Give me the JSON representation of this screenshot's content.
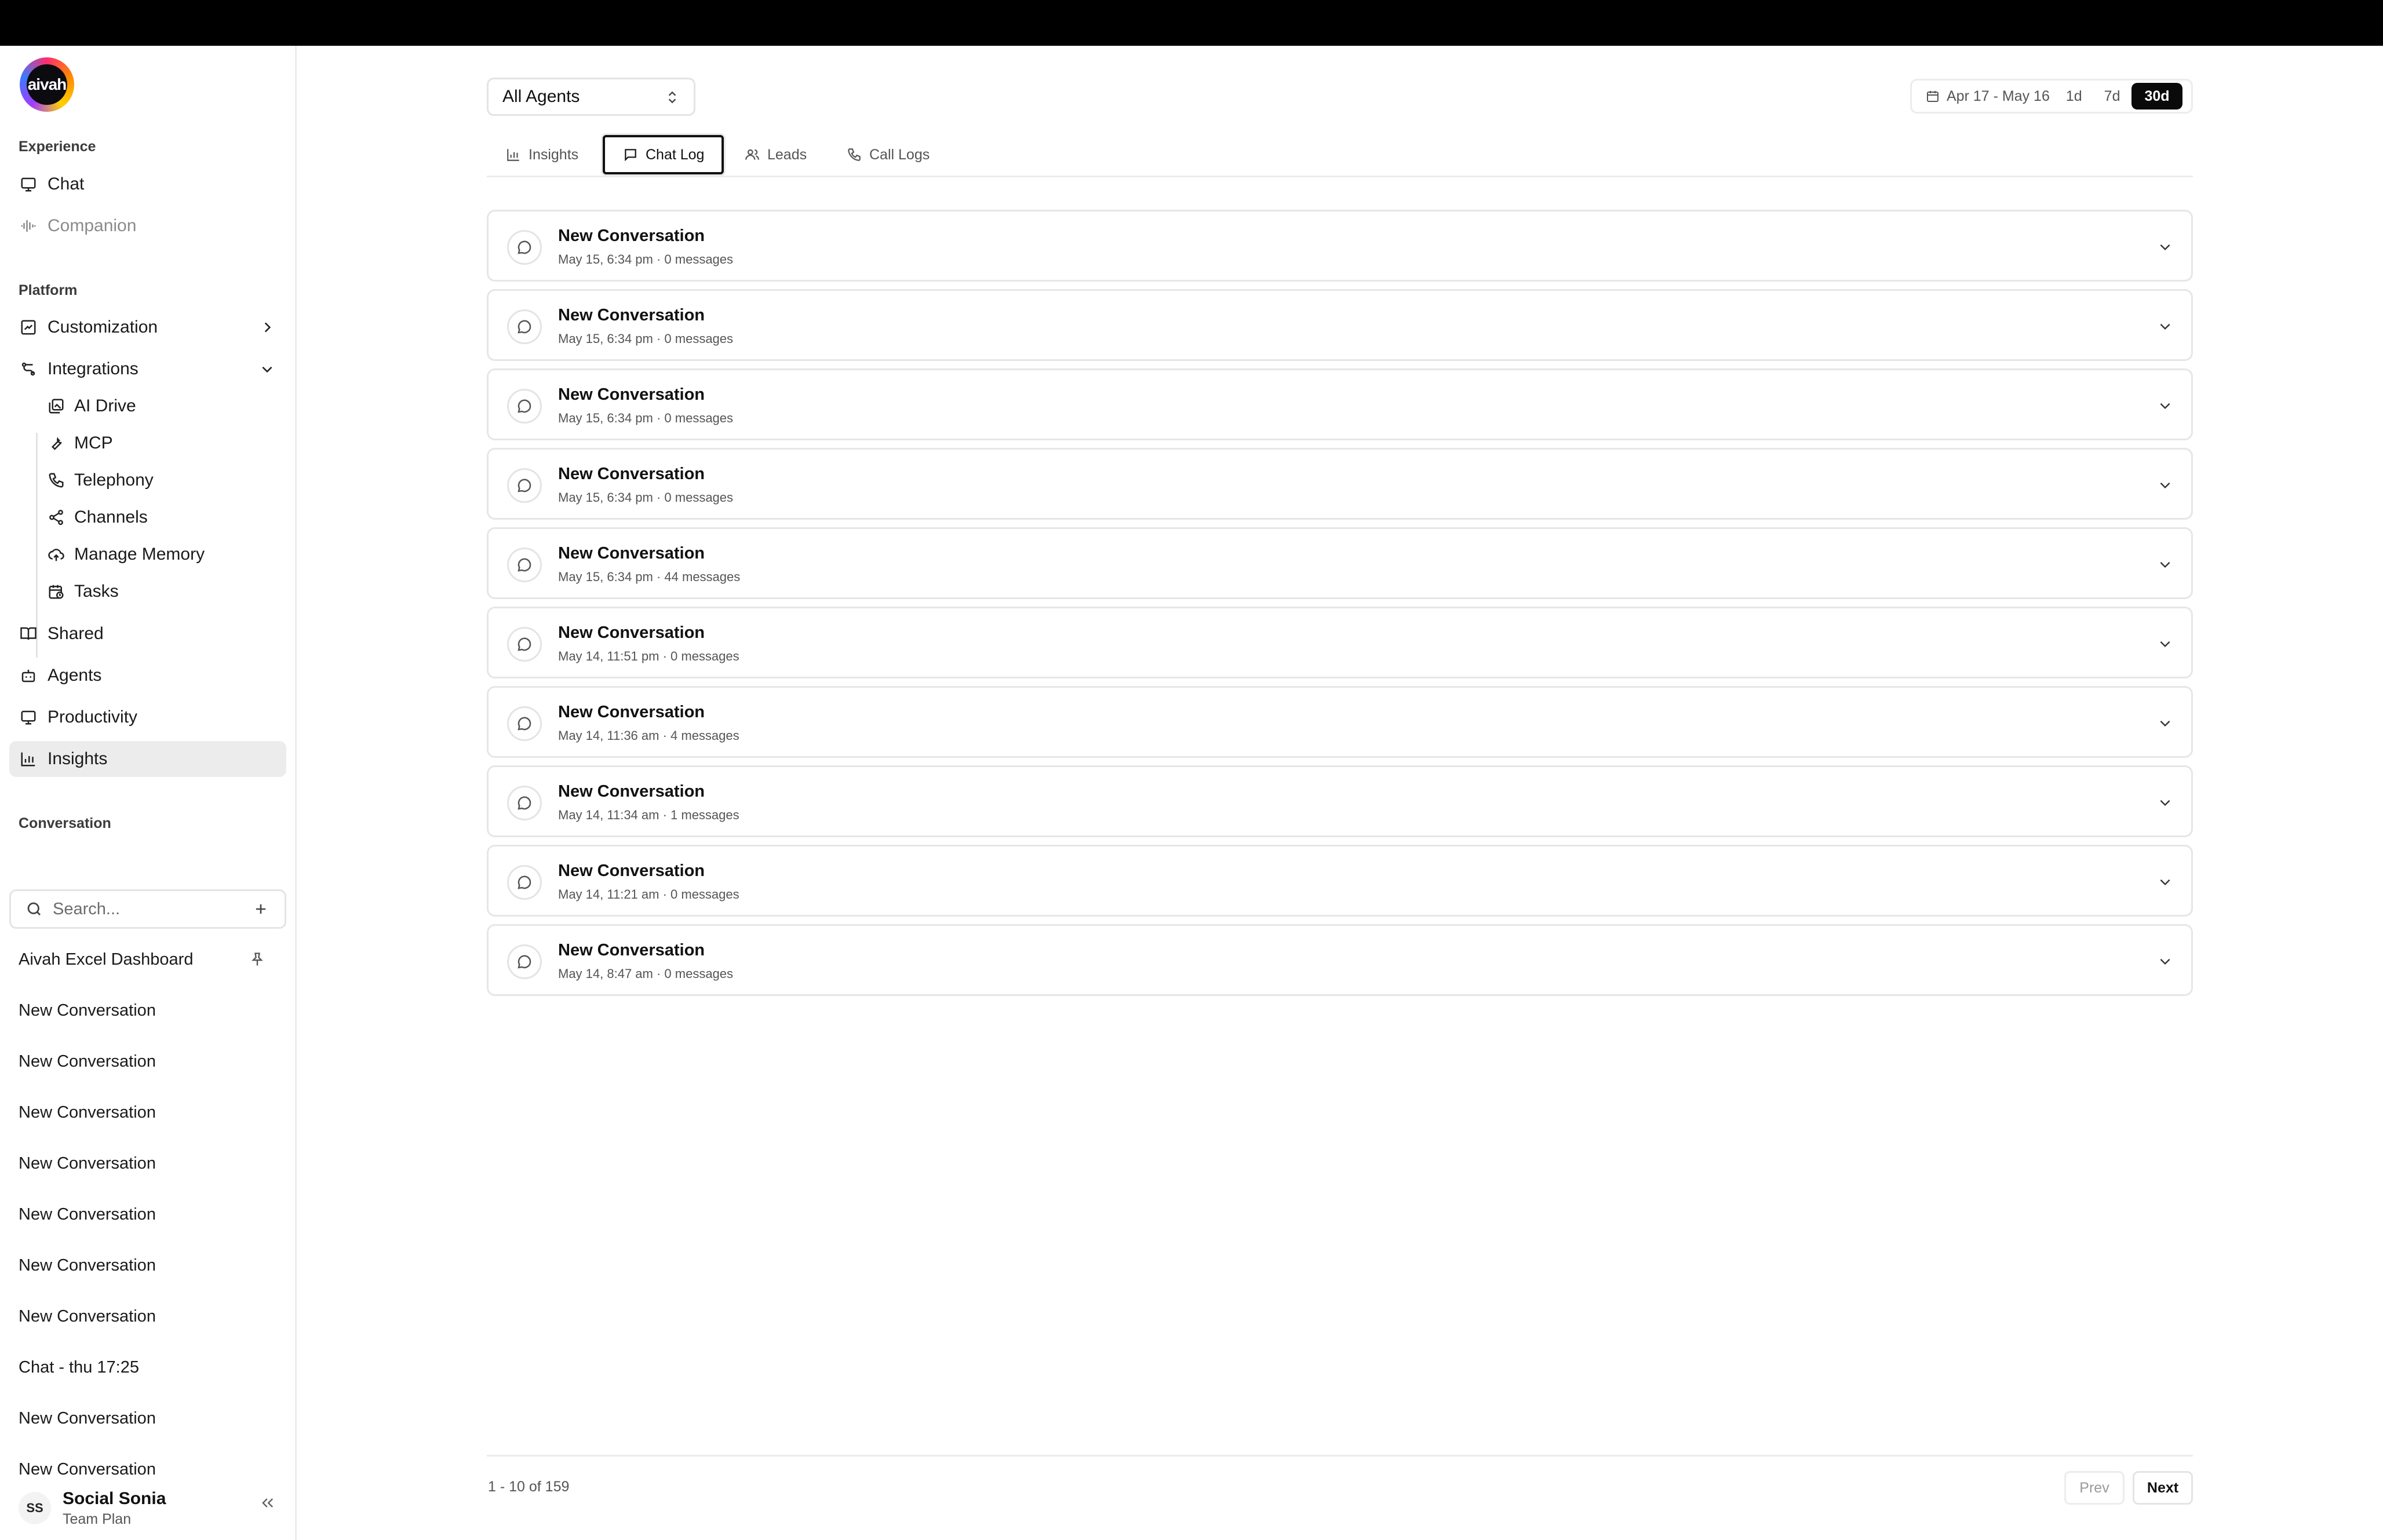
{
  "brand": {
    "logo_text": "aivah"
  },
  "sidebar": {
    "experience_label": "Experience",
    "chat": "Chat",
    "companion": "Companion",
    "platform_label": "Platform",
    "customization": "Customization",
    "integrations": "Integrations",
    "integrations_sub": [
      "AI Drive",
      "MCP",
      "Telephony",
      "Channels",
      "Manage Memory",
      "Tasks"
    ],
    "shared": "Shared",
    "agents": "Agents",
    "productivity": "Productivity",
    "insights": "Insights",
    "conversation_label": "Conversation",
    "search_placeholder": "Search...",
    "conversations": [
      "Aivah Excel Dashboard",
      "New Conversation",
      "New Conversation",
      "New Conversation",
      "New Conversation",
      "New Conversation",
      "New Conversation",
      "New Conversation",
      "Chat - thu 17:25",
      "New Conversation",
      "New Conversation"
    ],
    "user": {
      "initials": "SS",
      "name": "Social Sonia",
      "plan": "Team Plan"
    }
  },
  "toolbar": {
    "agent_select": "All Agents",
    "date_range": "Apr 17 - May 16",
    "ranges": [
      "1d",
      "7d",
      "30d"
    ],
    "active_range": "30d"
  },
  "tabs": [
    "Insights",
    "Chat Log",
    "Leads",
    "Call Logs"
  ],
  "active_tab": "Chat Log",
  "chat_log": [
    {
      "title": "New Conversation",
      "meta": "May 15, 6:34 pm · 0 messages"
    },
    {
      "title": "New Conversation",
      "meta": "May 15, 6:34 pm · 0 messages"
    },
    {
      "title": "New Conversation",
      "meta": "May 15, 6:34 pm · 0 messages"
    },
    {
      "title": "New Conversation",
      "meta": "May 15, 6:34 pm · 0 messages"
    },
    {
      "title": "New Conversation",
      "meta": "May 15, 6:34 pm · 44 messages"
    },
    {
      "title": "New Conversation",
      "meta": "May 14, 11:51 pm · 0 messages"
    },
    {
      "title": "New Conversation",
      "meta": "May 14, 11:36 am · 4 messages"
    },
    {
      "title": "New Conversation",
      "meta": "May 14, 11:34 am · 1 messages"
    },
    {
      "title": "New Conversation",
      "meta": "May 14, 11:21 am · 0 messages"
    },
    {
      "title": "New Conversation",
      "meta": "May 14, 8:47 am · 0 messages"
    }
  ],
  "pagination": {
    "info": "1 - 10 of 159",
    "prev": "Prev",
    "next": "Next"
  }
}
